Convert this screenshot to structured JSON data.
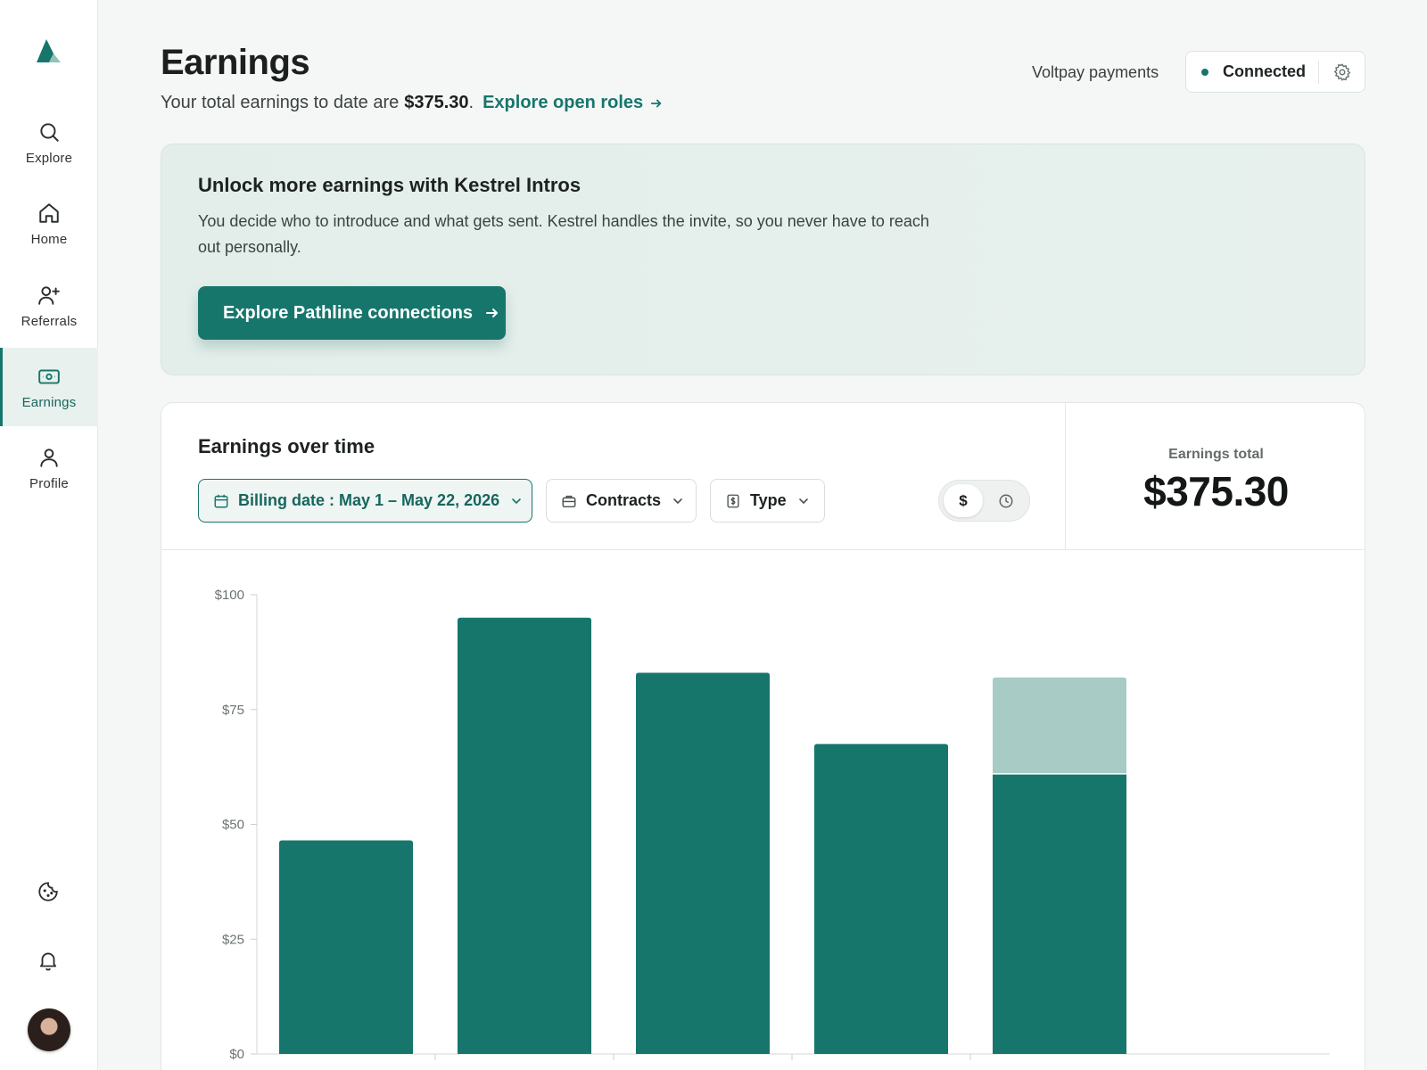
{
  "app": {
    "colors": {
      "accent": "#17766c",
      "accent_light": "#a8ccc5",
      "active_bg": "#e8f1ee"
    }
  },
  "sidebar": {
    "logo_icon": "mountain-logo-icon",
    "items": [
      {
        "label": "Explore",
        "icon": "search-icon"
      },
      {
        "label": "Home",
        "icon": "home-icon"
      },
      {
        "label": "Referrals",
        "icon": "user-plus-icon"
      },
      {
        "label": "Earnings",
        "icon": "banknote-icon",
        "active": true
      },
      {
        "label": "Profile",
        "icon": "user-icon"
      }
    ],
    "bottom_icons": [
      "cookie-icon",
      "bell-icon",
      "avatar"
    ]
  },
  "header": {
    "title": "Earnings",
    "subtitle_prefix": "Your total earnings to date are",
    "subtitle_amount": "$375.30",
    "subtitle_period": ".",
    "subtitle_link": "Explore open roles",
    "provider_label": "Voltpay payments",
    "connection_status": "Connected"
  },
  "promo": {
    "title": "Unlock more earnings with Kestrel Intros",
    "text": "You decide who to introduce and what gets sent. Kestrel handles the invite, so you never have to reach out personally.",
    "button_label": "Explore Pathline connections"
  },
  "chart_card": {
    "title": "Earnings over time",
    "filters": {
      "billing_date": "Billing date : May 1 – May 22, 2026",
      "contracts": "Contracts",
      "type": "Type"
    },
    "toggle": {
      "selected": "$",
      "other_icon": "clock-icon"
    },
    "total_label": "Earnings total",
    "total_value": "$375.30"
  },
  "chart_data": {
    "type": "bar",
    "stacked": true,
    "categories": [
      "",
      "",
      "",
      "",
      ""
    ],
    "series": [
      {
        "values": [
          46.5,
          95,
          83,
          67.5,
          61
        ],
        "color": "#17766c"
      },
      {
        "values": [
          0,
          0,
          0,
          0,
          21
        ],
        "color": "#a8ccc5"
      }
    ],
    "yticks": [
      "$0",
      "$25",
      "$50",
      "$75",
      "$100"
    ],
    "ylim": [
      0,
      100
    ],
    "xlabel": "",
    "ylabel": "",
    "grid": false
  }
}
